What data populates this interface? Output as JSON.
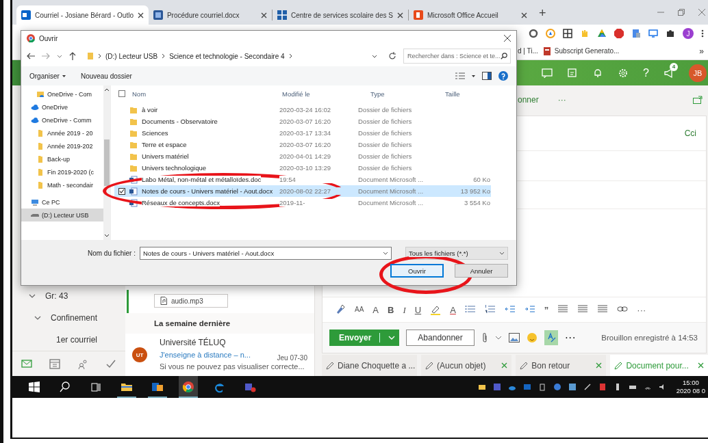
{
  "browser": {
    "tabs": [
      {
        "title": "Courriel - Josiane Bérard - Outlo",
        "selected": true
      },
      {
        "title": "Procédure courriel.docx",
        "selected": false
      },
      {
        "title": "Centre de services scolaire des S",
        "selected": false
      },
      {
        "title": "Microsoft Office Accueil",
        "selected": false
      }
    ],
    "new_tab_label": "+",
    "profile_initial": "J",
    "bookmarks": [
      "d | Ti...",
      "Subscript Generato..."
    ],
    "bookmarks_overflow": "»"
  },
  "dialog": {
    "title": "Ouvrir",
    "path": [
      "(D:) Lecteur USB",
      "Science et technologie - Secondaire 4"
    ],
    "search_placeholder": "Rechercher dans : Science et te...",
    "organize": "Organiser",
    "new_folder": "Nouveau dossier",
    "nav": [
      {
        "label": "OneDrive - Com",
        "kind": "shared",
        "selected": false
      },
      {
        "label": "OneDrive",
        "kind": "cloud",
        "selected": false
      },
      {
        "label": "OneDrive - Comm",
        "kind": "cloud",
        "selected": false,
        "children": [
          {
            "label": "Année 2019 - 20",
            "kind": "folder",
            "selected": false
          },
          {
            "label": "Année 2019-202",
            "kind": "folder",
            "selected": false
          },
          {
            "label": "Back-up",
            "kind": "folder",
            "selected": false
          },
          {
            "label": "Fin 2019-2020 (c",
            "kind": "folder",
            "selected": false
          },
          {
            "label": "Math - secondair",
            "kind": "folder",
            "selected": false
          }
        ]
      },
      {
        "label": "Ce PC",
        "kind": "pc",
        "selected": false
      },
      {
        "label": "(D:) Lecteur USB",
        "kind": "drive",
        "selected": true
      }
    ],
    "select_all_checked": false,
    "columns": [
      "Nom",
      "Modifié le",
      "Type",
      "Taille"
    ],
    "files": [
      {
        "name": "à voir",
        "kind": "folder",
        "modified": "2020-03-24 16:02",
        "type": "Dossier de fichiers",
        "selected": false,
        "checked": false
      },
      {
        "name": "Documents - Observatoire",
        "kind": "folder",
        "modified": "2020-03-07 16:20",
        "type": "Dossier de fichiers",
        "selected": false,
        "checked": false
      },
      {
        "name": "Sciences",
        "kind": "folder",
        "modified": "2020-03-17 13:34",
        "type": "Dossier de fichiers",
        "selected": false,
        "checked": false
      },
      {
        "name": "Terre et espace",
        "kind": "folder",
        "modified": "2020-03-07 16:20",
        "type": "Dossier de fichiers",
        "selected": false,
        "checked": false
      },
      {
        "name": "Univers matériel",
        "kind": "folder",
        "modified": "2020-04-01 14:29",
        "type": "Dossier de fichiers",
        "selected": false,
        "checked": false
      },
      {
        "name": "Univers technologique",
        "kind": "folder",
        "modified": "2020-03-10 13:29",
        "type": "Dossier de fichiers",
        "selected": false,
        "checked": false
      },
      {
        "name": "Labo Métal, non-métal et métalloïdes.doc",
        "kind": "document",
        "modified": "19:54",
        "type": "Document Microsoft ...",
        "size": "60 Ko",
        "selected": false,
        "checked": false
      },
      {
        "name": "Notes de cours - Univers matériel - Aout.docx",
        "kind": "document",
        "modified": "2020-08-02 22:27",
        "type": "Document Microsoft ...",
        "size": "13 952 Ko",
        "selected": true,
        "checked": true
      },
      {
        "name": "Réseaux de concepts.docx",
        "kind": "document",
        "modified": "2019-11-",
        "type": "Document Microsoft ...",
        "size": "3 554 Ko",
        "selected": false,
        "checked": false
      }
    ],
    "filename_label": "Nom du fichier :",
    "filename": "Notes de cours - Univers matériel - Aout.docx",
    "filter": "Tous les fichiers (*.*)",
    "buttons": [
      {
        "label": "Ouvrir",
        "kind": "primary"
      },
      {
        "label": "Annuler",
        "kind": "secondary"
      }
    ]
  },
  "outlook": {
    "help_label": "?",
    "notification_count": "4",
    "avatar": "JB",
    "command_label": "onner",
    "command_more": "···",
    "cc_label": "Cci",
    "folders": [
      {
        "label": "Gr: 43",
        "expanded": true,
        "children": [
          {
            "label": "Confinement",
            "expanded": true,
            "children": [
              {
                "label": "1er courriel"
              }
            ]
          }
        ]
      }
    ],
    "app_bar": [
      {
        "kind": "mail",
        "selected": true
      },
      {
        "kind": "calendar",
        "selected": false
      },
      {
        "kind": "people",
        "selected": false
      },
      {
        "kind": "tasks",
        "selected": false
      }
    ],
    "attachment": "audio.mp3",
    "group": "La semaine dernière",
    "messages": [
      {
        "avatar": "UT",
        "sender": "Université TÉLUQ",
        "subject": "J'enseigne à distance – n...",
        "date": "Jeu 07-30",
        "preview": "Si vous ne pouvez pas visualiser correcte..."
      }
    ],
    "format_buttons": [
      {
        "kind": "painter"
      },
      {
        "kind": "font-size",
        "label": "AA"
      },
      {
        "kind": "grow",
        "label": "A"
      },
      {
        "kind": "bold",
        "label": "B"
      },
      {
        "kind": "italic",
        "label": "I"
      },
      {
        "kind": "underline",
        "label": "U"
      },
      {
        "kind": "highlight"
      },
      {
        "kind": "font-color",
        "label": "A"
      },
      {
        "kind": "bullets"
      },
      {
        "kind": "numbering"
      },
      {
        "kind": "outdent"
      },
      {
        "kind": "indent"
      },
      {
        "kind": "quote",
        "label": "”"
      },
      {
        "kind": "align"
      },
      {
        "kind": "align"
      },
      {
        "kind": "align"
      },
      {
        "kind": "link"
      },
      {
        "kind": "more",
        "label": "···"
      }
    ],
    "send_label": "Envoyer",
    "discard_label": "Abandonner",
    "send_more": "···",
    "draft_status": "Brouillon enregistré à 14:53",
    "drafts": [
      {
        "title": "Diane Choquette a ...",
        "selected": false,
        "closable": false
      },
      {
        "title": "(Aucun objet)",
        "selected": false,
        "closable": true
      },
      {
        "title": "Bon retour",
        "selected": false,
        "closable": true
      },
      {
        "title": "Document pour...",
        "selected": true,
        "closable": true
      }
    ]
  },
  "taskbar": {
    "time": "15:00",
    "date": "2020 08 0"
  }
}
